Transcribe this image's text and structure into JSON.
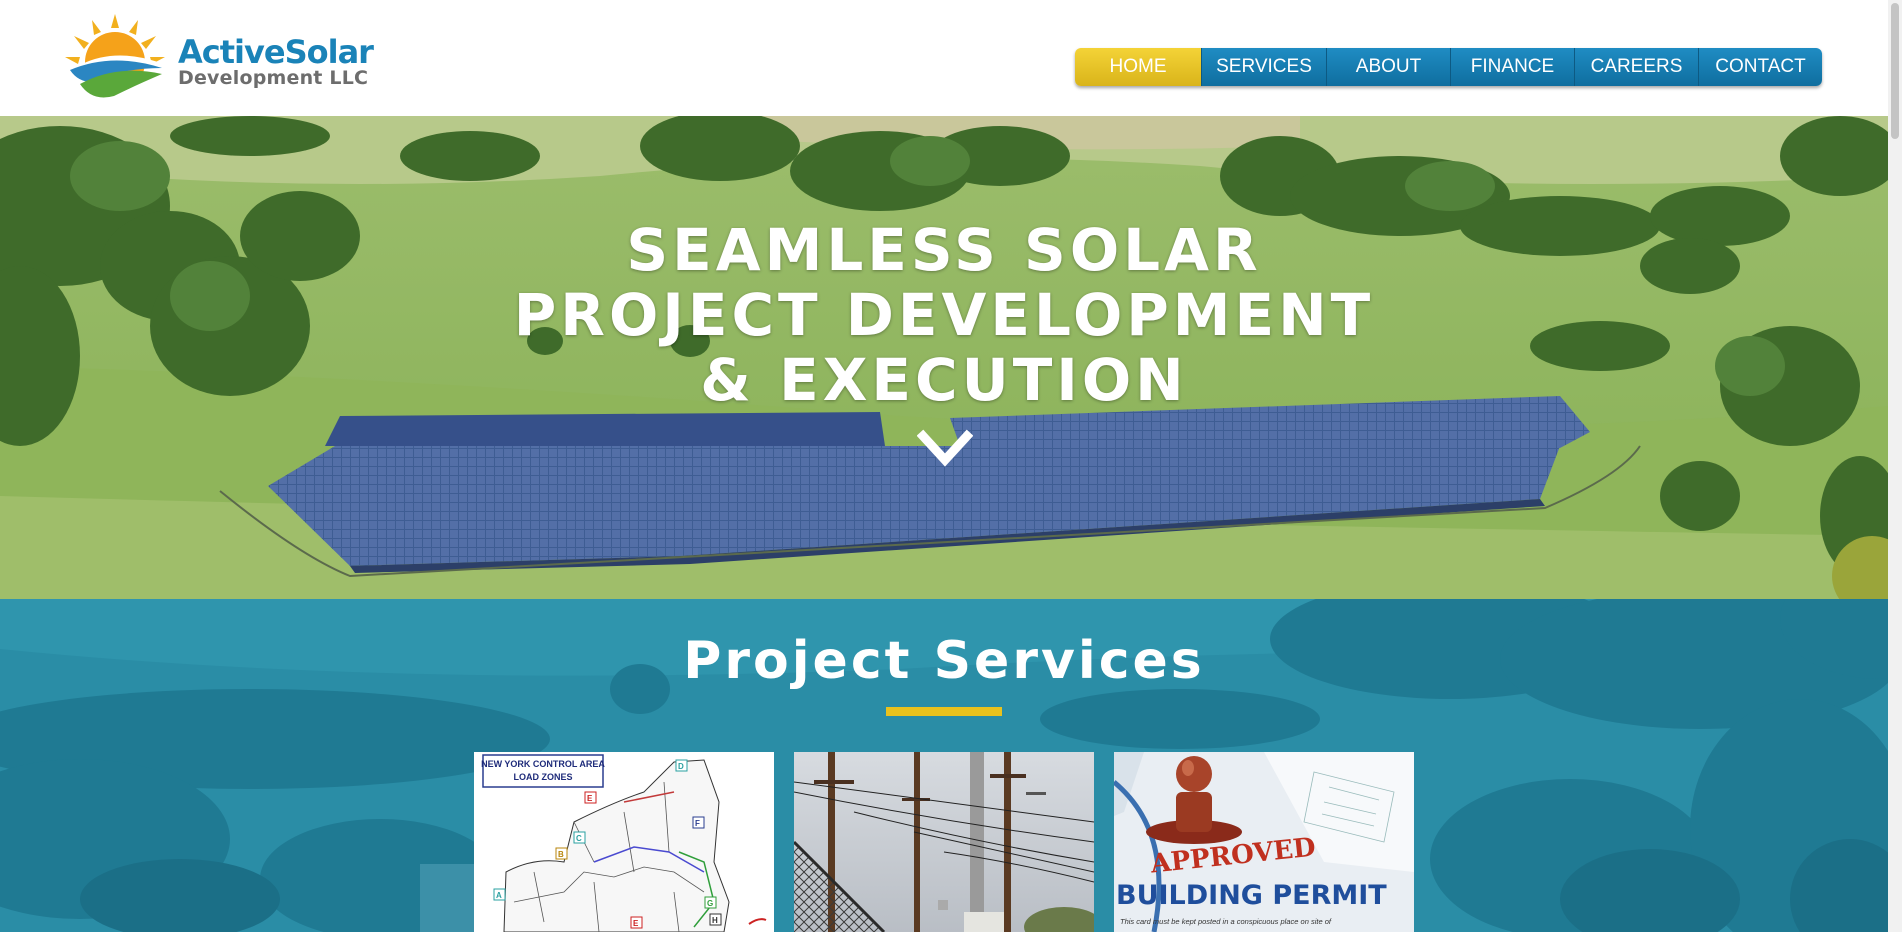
{
  "logo": {
    "name_part1": "Active",
    "name_part2": "Solar",
    "subtitle": "Development LLC",
    "icon": "sun-over-waves-icon"
  },
  "nav": {
    "items": [
      {
        "label": "HOME",
        "active": true
      },
      {
        "label": "SERVICES",
        "active": false
      },
      {
        "label": "ABOUT",
        "active": false
      },
      {
        "label": "FINANCE",
        "active": false
      },
      {
        "label": "CAREERS",
        "active": false
      },
      {
        "label": "CONTACT",
        "active": false
      }
    ]
  },
  "hero": {
    "line1": "SEAMLESS SOLAR",
    "line2": "PROJECT DEVELOPMENT",
    "line3": "& EXECUTION",
    "scroll_icon": "chevron-down-icon"
  },
  "services": {
    "title": "Project Services",
    "cards": [
      {
        "map_title_line1": "NEW YORK CONTROL AREA",
        "map_title_line2": "LOAD ZONES",
        "image": "load-zones-map-image"
      },
      {
        "image": "utility-poles-image"
      },
      {
        "stamp_text": "APPROVED",
        "permit_text": "BUILDING PERMIT",
        "small_text": "This card must be kept posted in a conspicuous place on site of",
        "image": "building-permit-image"
      }
    ]
  },
  "colors": {
    "brand_blue": "#1a83b8",
    "nav_active": "#e8c42a",
    "accent_yellow": "#e9c21d",
    "overlay_teal": "#1d89a8"
  }
}
